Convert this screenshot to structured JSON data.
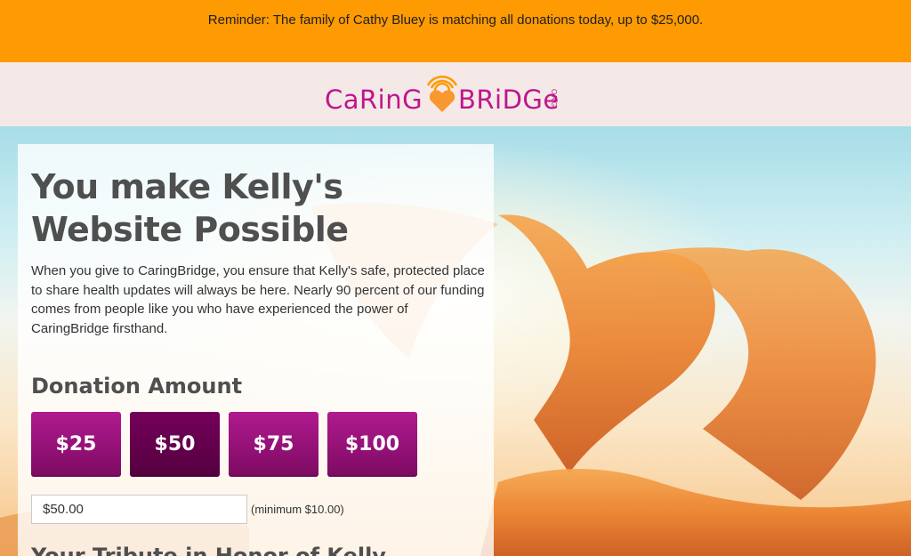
{
  "reminder": {
    "text": "Reminder: The family of Cathy Bluey is matching all donations today, up to $25,000."
  },
  "brand": {
    "logo_left": "CaRinG",
    "logo_right": "BRiDGe",
    "logo_org": "ORG",
    "color": "#c0158e"
  },
  "panel": {
    "title": "You make Kelly's Website Possible",
    "description": "When you give to CaringBridge, you ensure that Kelly's safe, protected place to share health updates will always be here. Nearly 90 percent of our funding comes from people like you who have experienced the power of CaringBridge firsthand.",
    "donation_heading": "Donation Amount",
    "amounts": [
      {
        "label": "$25",
        "selected": false
      },
      {
        "label": "$50",
        "selected": true
      },
      {
        "label": "$75",
        "selected": false
      },
      {
        "label": "$100",
        "selected": false
      }
    ],
    "custom_amount_value": "$50.00",
    "minimum_note": "(minimum $10.00)",
    "tribute_heading": "Your Tribute in Honor of Kelly"
  },
  "colors": {
    "reminder_bg": "#fe9a02",
    "brand_bg": "#f4e9e6",
    "button": "#9c1179",
    "button_selected": "#5e0048"
  }
}
